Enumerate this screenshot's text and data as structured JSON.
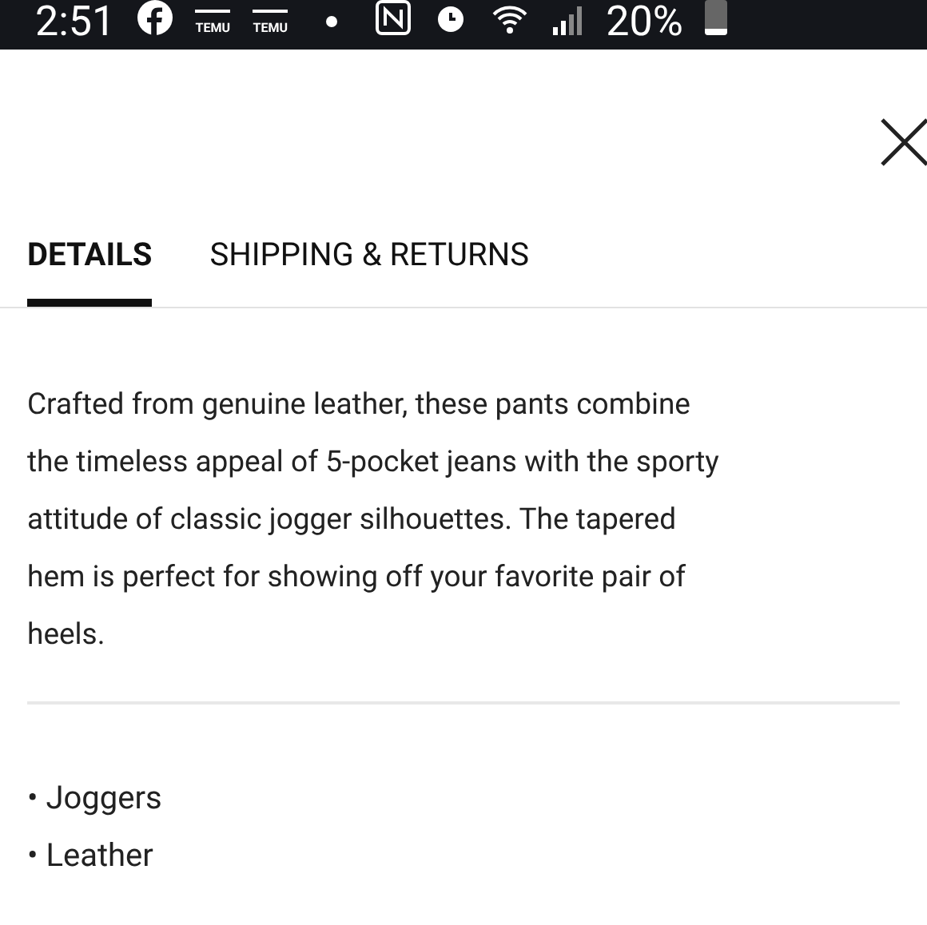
{
  "status_bar": {
    "time": "2:51",
    "notification_labels": [
      "TEMU",
      "TEMU"
    ],
    "battery_text": "20%"
  },
  "tabs": [
    {
      "label": "DETAILS",
      "selected": true
    },
    {
      "label": "SHIPPING & RETURNS",
      "selected": false
    }
  ],
  "description_lines": [
    "Crafted from genuine leather, these pants combine",
    "the timeless appeal of 5-pocket jeans with the sporty",
    "attitude of classic jogger silhouettes. The tapered",
    "hem is perfect for showing off your favorite pair of",
    "heels."
  ],
  "features": [
    "• Joggers",
    "• Leather"
  ]
}
